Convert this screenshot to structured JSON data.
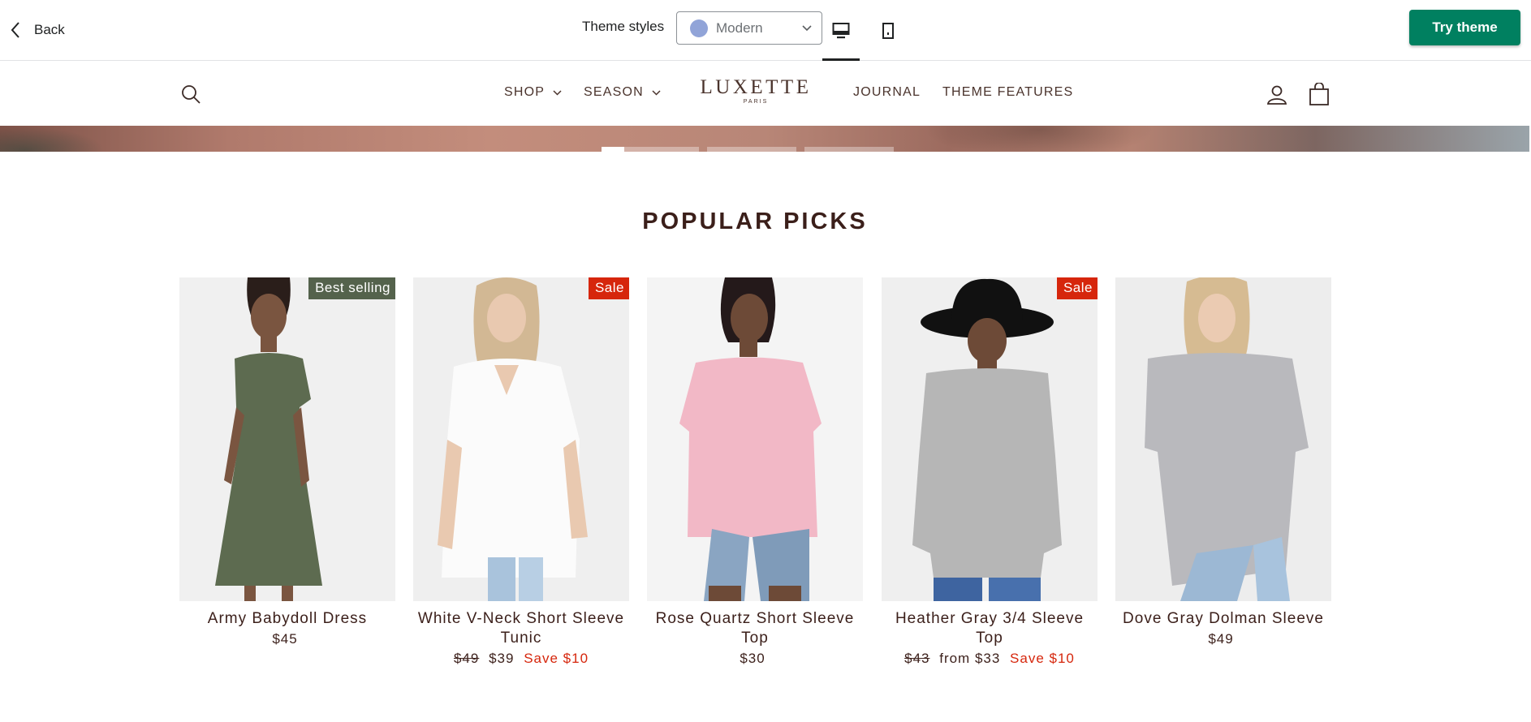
{
  "topbar": {
    "back_label": "Back",
    "theme_styles_label": "Theme styles",
    "theme_selected": "Modern",
    "theme_swatch_color": "#91a4d8",
    "try_theme_label": "Try theme",
    "try_theme_color": "#008060",
    "devices": [
      "desktop-icon",
      "mobile-icon"
    ]
  },
  "store": {
    "logo": "LUXETTE",
    "logo_sub": "PARIS",
    "nav": {
      "shop": "SHOP",
      "season": "SEASON",
      "journal": "JOURNAL",
      "features": "THEME FEATURES"
    },
    "icons": [
      "search-icon",
      "account-icon",
      "shopping-bag-icon"
    ]
  },
  "section": {
    "title": "POPULAR PICKS"
  },
  "products": [
    {
      "name": "Army Babydoll Dress",
      "badge": "Best selling",
      "price": "$45"
    },
    {
      "name": "White V-Neck Short Sleeve Tunic",
      "badge": "Sale",
      "old_price": "$49",
      "price": "$39",
      "save": "Save $10"
    },
    {
      "name": "Rose Quartz Short Sleeve Top",
      "price": "$30"
    },
    {
      "name": "Heather Gray 3/4 Sleeve Top",
      "badge": "Sale",
      "old_price": "$43",
      "price": "from $33",
      "save": "Save $10"
    },
    {
      "name": "Dove Gray Dolman Sleeve",
      "price": "$49"
    }
  ],
  "colors": {
    "sale_badge": "#d6260c",
    "best_badge": "#54624c",
    "text_primary": "#3b1f1a"
  }
}
